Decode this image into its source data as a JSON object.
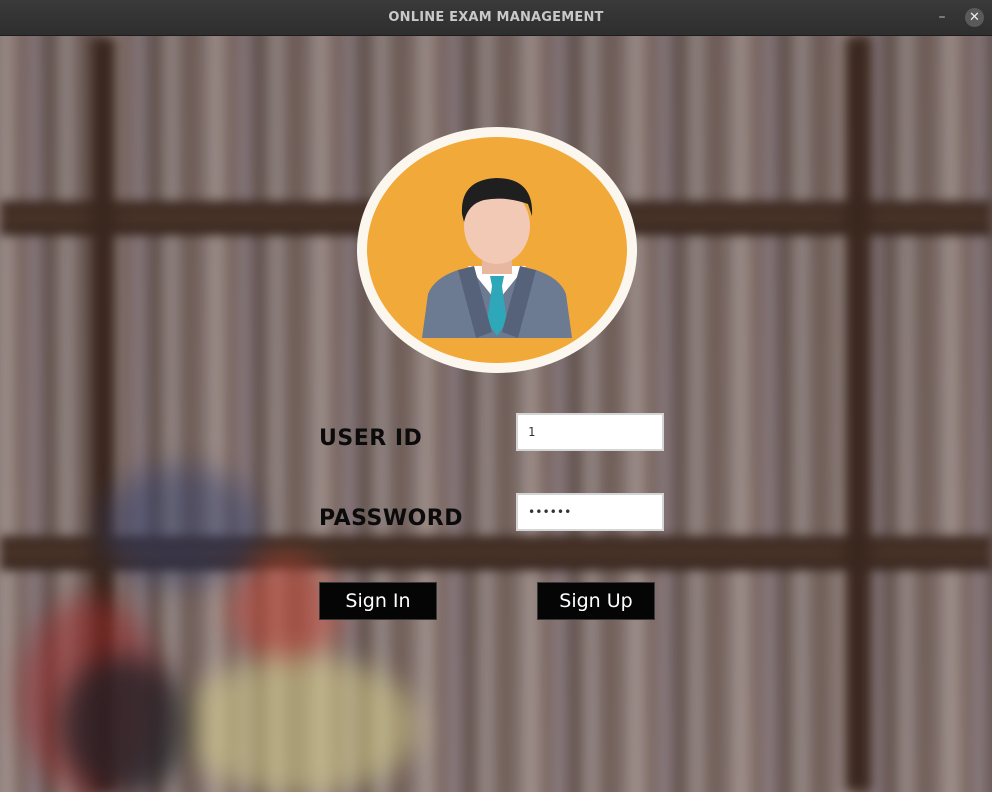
{
  "window": {
    "title": "ONLINE EXAM MANAGEMENT",
    "minimize_glyph": "–",
    "close_glyph": "✕"
  },
  "avatar": {
    "icon": "user-avatar-icon",
    "colors": {
      "ring": "#fbf7ef",
      "fill": "#f1a93a",
      "suit": "#6d7b92",
      "tie": "#2ea7b8",
      "hair": "#1f1f1f",
      "skin": "#f2c9b4"
    }
  },
  "form": {
    "user_id_label": "USER ID",
    "user_id_value": "1",
    "password_label": "PASSWORD",
    "password_value": "••••••",
    "sign_in_label": "Sign In",
    "sign_up_label": "Sign Up"
  },
  "colors": {
    "button_bg": "#050505",
    "button_text": "#ffffff",
    "label_text": "#0b0b0b"
  }
}
